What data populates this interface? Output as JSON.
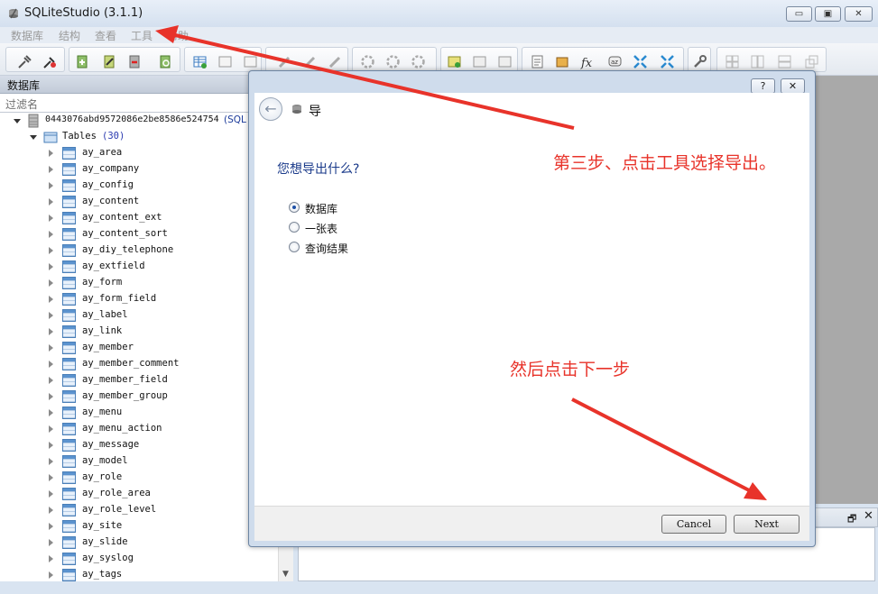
{
  "window": {
    "title": "SQLiteStudio (3.1.1)",
    "min_glyph": "▭",
    "max_glyph": "▣",
    "close_glyph": "✕"
  },
  "menu": [
    "数据库",
    "结构",
    "查看",
    "工具",
    "帮助"
  ],
  "db_panel": {
    "title": "数据库",
    "filter_placeholder": "过滤名",
    "db_name": "0443076abd9572086e2be8586e524754",
    "db_suffix": "(SQL",
    "tables_label": "Tables",
    "tables_count": "(30)",
    "tables": [
      "ay_area",
      "ay_company",
      "ay_config",
      "ay_content",
      "ay_content_ext",
      "ay_content_sort",
      "ay_diy_telephone",
      "ay_extfield",
      "ay_form",
      "ay_form_field",
      "ay_label",
      "ay_link",
      "ay_member",
      "ay_member_comment",
      "ay_member_field",
      "ay_member_group",
      "ay_menu",
      "ay_menu_action",
      "ay_message",
      "ay_model",
      "ay_role",
      "ay_role_area",
      "ay_role_level",
      "ay_site",
      "ay_slide",
      "ay_syslog",
      "ay_tags"
    ]
  },
  "dialog": {
    "help_glyph": "?",
    "close_glyph": "✕",
    "back_glyph": "←",
    "title": "导",
    "question": "您想导出什么?",
    "options": [
      {
        "label": "数据库",
        "checked": true
      },
      {
        "label": "一张表",
        "checked": false
      },
      {
        "label": "查询结果",
        "checked": false
      }
    ],
    "cancel_label": "Cancel",
    "next_label": "Next"
  },
  "dock": {
    "float_glyph": "🗗",
    "close_glyph": "✕"
  },
  "annotations": {
    "step3": "第三步、点击工具选择导出。",
    "then_next": "然后点击下一步",
    "color": "#e8332a"
  }
}
